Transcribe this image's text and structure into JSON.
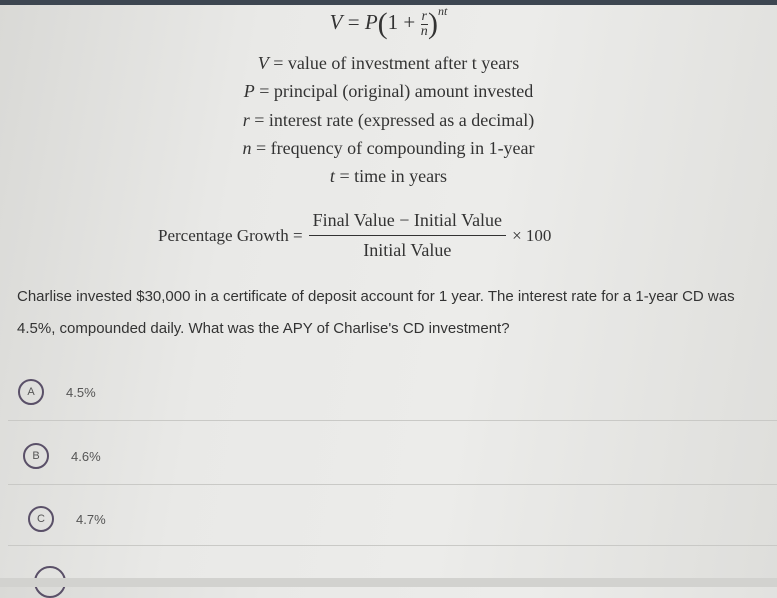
{
  "formula": {
    "lhs": "V",
    "eq": "=",
    "p": "P",
    "one_plus": "1 +",
    "num": "r",
    "den": "n",
    "exp": "nt"
  },
  "definitions": [
    {
      "var": "V",
      "text": "= value of investment after t years"
    },
    {
      "var": "P",
      "text": "= principal (original) amount invested"
    },
    {
      "var": "r",
      "text": "= interest rate (expressed as a decimal)"
    },
    {
      "var": "n",
      "text": "= frequency of compounding in 1-year"
    },
    {
      "var": "t",
      "text": "= time in years"
    }
  ],
  "percentage_growth": {
    "label": "Percentage Growth =",
    "numerator": "Final Value − Initial Value",
    "denominator": "Initial Value",
    "times": "× 100"
  },
  "question": "Charlise invested $30,000 in a certificate of deposit account for 1 year. The interest rate for a 1-year CD was 4.5%, compounded daily. What was the APY of Charlise's CD investment?",
  "options": [
    {
      "letter": "A",
      "text": "4.5%"
    },
    {
      "letter": "B",
      "text": "4.6%"
    },
    {
      "letter": "C",
      "text": "4.7%"
    }
  ]
}
